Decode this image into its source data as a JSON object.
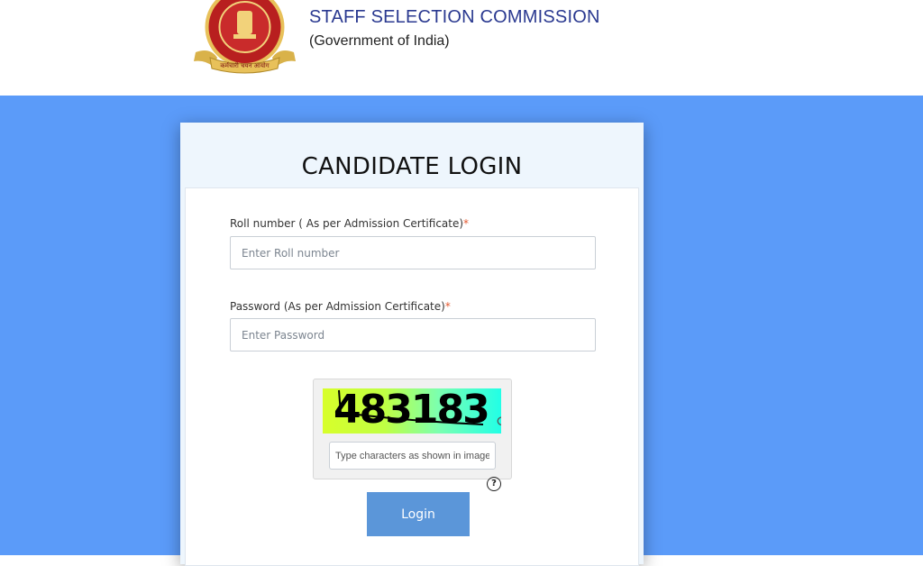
{
  "header": {
    "org_name": "STAFF SELECTION COMMISSION",
    "org_subtitle": "(Government of India)",
    "logo_text": "कर्मचारी चयन आयोग"
  },
  "login": {
    "title": "CANDIDATE LOGIN",
    "roll_label": "Roll number ( As per Admission Certificate)",
    "roll_placeholder": "Enter Roll number",
    "password_label": "Password (As per Admission Certificate)",
    "password_placeholder": "Enter Password",
    "required_mark": "*",
    "captcha_value": "483183",
    "captcha_placeholder": "Type characters as shown in image",
    "help_symbol": "?",
    "refresh_icon": "refresh-icon",
    "login_button": "Login"
  },
  "colors": {
    "band": "#5b9bf9",
    "button": "#5b96d9",
    "title_text": "#2a3990",
    "required": "#e4572e"
  }
}
